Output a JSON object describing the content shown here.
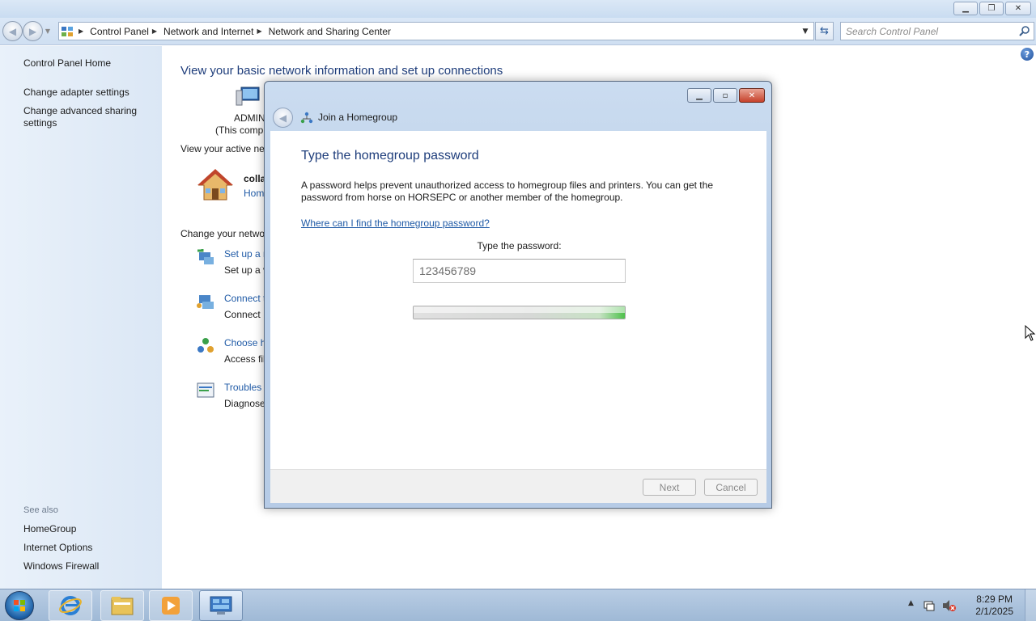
{
  "explorer": {
    "breadcrumbs": [
      "Control Panel",
      "Network and Internet",
      "Network and Sharing Center"
    ],
    "search_placeholder": "Search Control Panel",
    "help_label": "?"
  },
  "sidebar": {
    "items": [
      "Control Panel Home",
      "Change adapter settings",
      "Change advanced sharing settings"
    ],
    "see_also_label": "See also",
    "see_also": [
      "HomeGroup",
      "Internet Options",
      "Windows Firewall"
    ]
  },
  "main": {
    "heading": "View your basic network information and set up connections",
    "computer_name": "ADMIN",
    "computer_sub": "(This comp",
    "active_networks_label": "View your active ne",
    "network_name": "colla",
    "network_type": "Hom",
    "change_settings_label": "Change your netwo",
    "tasks": [
      {
        "link": "Set up a n",
        "desc": "Set up a v"
      },
      {
        "link": "Connect t",
        "desc": "Connect"
      },
      {
        "link": "Choose h",
        "desc": "Access fil"
      },
      {
        "link": "Troubles",
        "desc": "Diagnose"
      }
    ]
  },
  "dialog": {
    "title": "Join a Homegroup",
    "heading": "Type the homegroup password",
    "description": "A password helps prevent unauthorized access to homegroup files and printers. You can get the password from horse on HORSEPC or another member of the homegroup.",
    "help_link": "Where can I find the homegroup password?",
    "password_label": "Type the password:",
    "password_value": "123456789",
    "progress": 1.0,
    "next_label": "Next",
    "cancel_label": "Cancel"
  },
  "taskbar": {
    "time": "8:29 PM",
    "date": "2/1/2025"
  },
  "colors": {
    "heading": "#1e3d7b",
    "link": "#1f5aa6",
    "progress_end": "#4ec14b"
  }
}
